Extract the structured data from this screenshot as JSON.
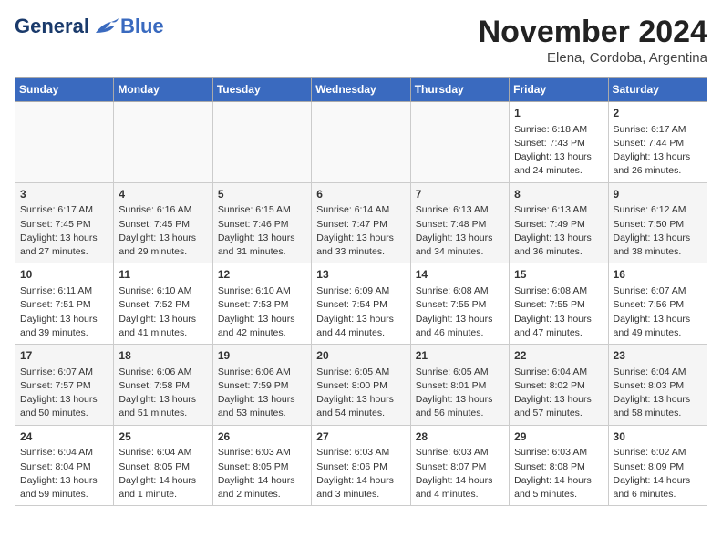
{
  "header": {
    "logo_general": "General",
    "logo_blue": "Blue",
    "month_title": "November 2024",
    "subtitle": "Elena, Cordoba, Argentina"
  },
  "days_of_week": [
    "Sunday",
    "Monday",
    "Tuesday",
    "Wednesday",
    "Thursday",
    "Friday",
    "Saturday"
  ],
  "weeks": [
    [
      {
        "day": "",
        "info": ""
      },
      {
        "day": "",
        "info": ""
      },
      {
        "day": "",
        "info": ""
      },
      {
        "day": "",
        "info": ""
      },
      {
        "day": "",
        "info": ""
      },
      {
        "day": "1",
        "info": "Sunrise: 6:18 AM\nSunset: 7:43 PM\nDaylight: 13 hours\nand 24 minutes."
      },
      {
        "day": "2",
        "info": "Sunrise: 6:17 AM\nSunset: 7:44 PM\nDaylight: 13 hours\nand 26 minutes."
      }
    ],
    [
      {
        "day": "3",
        "info": "Sunrise: 6:17 AM\nSunset: 7:45 PM\nDaylight: 13 hours\nand 27 minutes."
      },
      {
        "day": "4",
        "info": "Sunrise: 6:16 AM\nSunset: 7:45 PM\nDaylight: 13 hours\nand 29 minutes."
      },
      {
        "day": "5",
        "info": "Sunrise: 6:15 AM\nSunset: 7:46 PM\nDaylight: 13 hours\nand 31 minutes."
      },
      {
        "day": "6",
        "info": "Sunrise: 6:14 AM\nSunset: 7:47 PM\nDaylight: 13 hours\nand 33 minutes."
      },
      {
        "day": "7",
        "info": "Sunrise: 6:13 AM\nSunset: 7:48 PM\nDaylight: 13 hours\nand 34 minutes."
      },
      {
        "day": "8",
        "info": "Sunrise: 6:13 AM\nSunset: 7:49 PM\nDaylight: 13 hours\nand 36 minutes."
      },
      {
        "day": "9",
        "info": "Sunrise: 6:12 AM\nSunset: 7:50 PM\nDaylight: 13 hours\nand 38 minutes."
      }
    ],
    [
      {
        "day": "10",
        "info": "Sunrise: 6:11 AM\nSunset: 7:51 PM\nDaylight: 13 hours\nand 39 minutes."
      },
      {
        "day": "11",
        "info": "Sunrise: 6:10 AM\nSunset: 7:52 PM\nDaylight: 13 hours\nand 41 minutes."
      },
      {
        "day": "12",
        "info": "Sunrise: 6:10 AM\nSunset: 7:53 PM\nDaylight: 13 hours\nand 42 minutes."
      },
      {
        "day": "13",
        "info": "Sunrise: 6:09 AM\nSunset: 7:54 PM\nDaylight: 13 hours\nand 44 minutes."
      },
      {
        "day": "14",
        "info": "Sunrise: 6:08 AM\nSunset: 7:55 PM\nDaylight: 13 hours\nand 46 minutes."
      },
      {
        "day": "15",
        "info": "Sunrise: 6:08 AM\nSunset: 7:55 PM\nDaylight: 13 hours\nand 47 minutes."
      },
      {
        "day": "16",
        "info": "Sunrise: 6:07 AM\nSunset: 7:56 PM\nDaylight: 13 hours\nand 49 minutes."
      }
    ],
    [
      {
        "day": "17",
        "info": "Sunrise: 6:07 AM\nSunset: 7:57 PM\nDaylight: 13 hours\nand 50 minutes."
      },
      {
        "day": "18",
        "info": "Sunrise: 6:06 AM\nSunset: 7:58 PM\nDaylight: 13 hours\nand 51 minutes."
      },
      {
        "day": "19",
        "info": "Sunrise: 6:06 AM\nSunset: 7:59 PM\nDaylight: 13 hours\nand 53 minutes."
      },
      {
        "day": "20",
        "info": "Sunrise: 6:05 AM\nSunset: 8:00 PM\nDaylight: 13 hours\nand 54 minutes."
      },
      {
        "day": "21",
        "info": "Sunrise: 6:05 AM\nSunset: 8:01 PM\nDaylight: 13 hours\nand 56 minutes."
      },
      {
        "day": "22",
        "info": "Sunrise: 6:04 AM\nSunset: 8:02 PM\nDaylight: 13 hours\nand 57 minutes."
      },
      {
        "day": "23",
        "info": "Sunrise: 6:04 AM\nSunset: 8:03 PM\nDaylight: 13 hours\nand 58 minutes."
      }
    ],
    [
      {
        "day": "24",
        "info": "Sunrise: 6:04 AM\nSunset: 8:04 PM\nDaylight: 13 hours\nand 59 minutes."
      },
      {
        "day": "25",
        "info": "Sunrise: 6:04 AM\nSunset: 8:05 PM\nDaylight: 14 hours\nand 1 minute."
      },
      {
        "day": "26",
        "info": "Sunrise: 6:03 AM\nSunset: 8:05 PM\nDaylight: 14 hours\nand 2 minutes."
      },
      {
        "day": "27",
        "info": "Sunrise: 6:03 AM\nSunset: 8:06 PM\nDaylight: 14 hours\nand 3 minutes."
      },
      {
        "day": "28",
        "info": "Sunrise: 6:03 AM\nSunset: 8:07 PM\nDaylight: 14 hours\nand 4 minutes."
      },
      {
        "day": "29",
        "info": "Sunrise: 6:03 AM\nSunset: 8:08 PM\nDaylight: 14 hours\nand 5 minutes."
      },
      {
        "day": "30",
        "info": "Sunrise: 6:02 AM\nSunset: 8:09 PM\nDaylight: 14 hours\nand 6 minutes."
      }
    ]
  ]
}
